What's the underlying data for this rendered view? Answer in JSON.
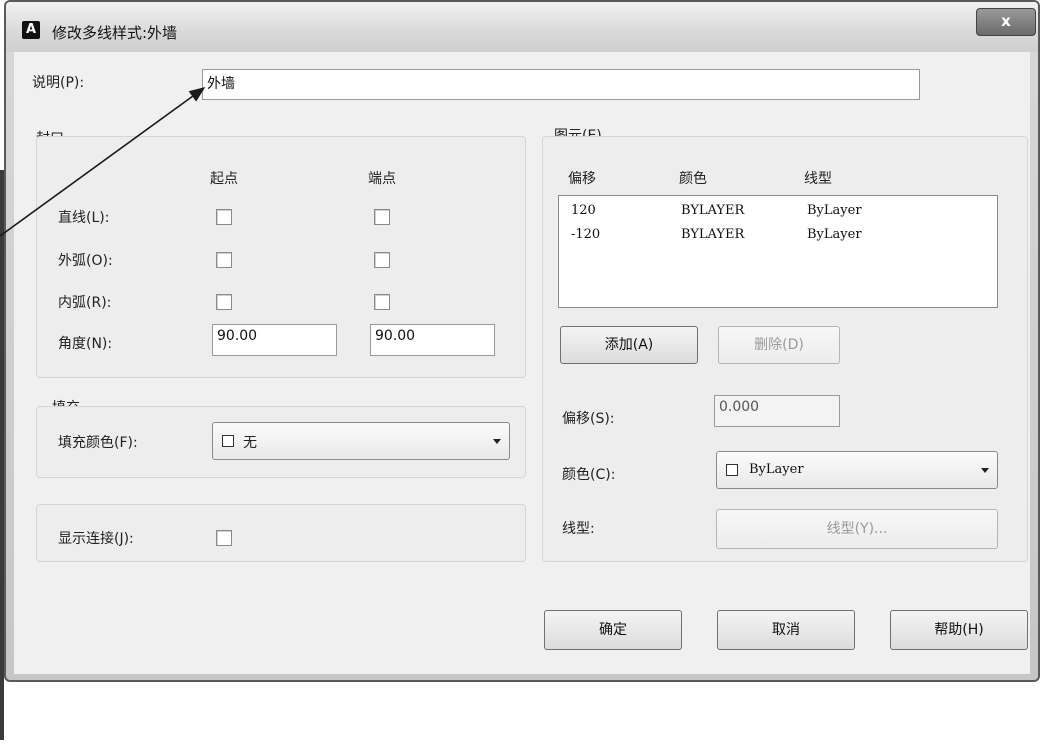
{
  "window": {
    "title": "修改多线样式:外墙",
    "app_icon_letter": "A",
    "close_label": "x"
  },
  "description": {
    "label": "说明(P):",
    "value": "外墙"
  },
  "caps": {
    "group_label": "封口",
    "col_start": "起点",
    "col_end": "端点",
    "rows": [
      {
        "label": "直线(L):",
        "start_checked": false,
        "end_checked": false
      },
      {
        "label": "外弧(O):",
        "start_checked": false,
        "end_checked": false
      },
      {
        "label": "内弧(R):",
        "start_checked": false,
        "end_checked": false
      }
    ],
    "angle_label": "角度(N):",
    "angle_start": "90.00",
    "angle_end": "90.00"
  },
  "fill": {
    "group_label": "填充",
    "color_label": "填充颜色(F):",
    "color_value": "无"
  },
  "joints": {
    "label": "显示连接(J):",
    "checked": false
  },
  "elements": {
    "group_label": "图元(E)",
    "col_offset": "偏移",
    "col_color": "颜色",
    "col_linetype": "线型",
    "rows": [
      {
        "offset": "120",
        "color": "BYLAYER",
        "linetype": "ByLayer"
      },
      {
        "offset": "-120",
        "color": "BYLAYER",
        "linetype": "ByLayer"
      }
    ],
    "add_label": "添加(A)",
    "delete_label": "删除(D)",
    "offset_label": "偏移(S):",
    "offset_value": "0.000",
    "color_label": "颜色(C):",
    "color_value": "ByLayer",
    "linetype_label": "线型:",
    "linetype_button": "线型(Y)..."
  },
  "footer": {
    "ok_label": "确定",
    "cancel_label": "取消",
    "help_label": "帮助(H)"
  },
  "colors": {
    "window_frame": "#5a5a5a",
    "dialog_bg": "#f0f0f0",
    "annotation_line": "#1a1a1a"
  }
}
